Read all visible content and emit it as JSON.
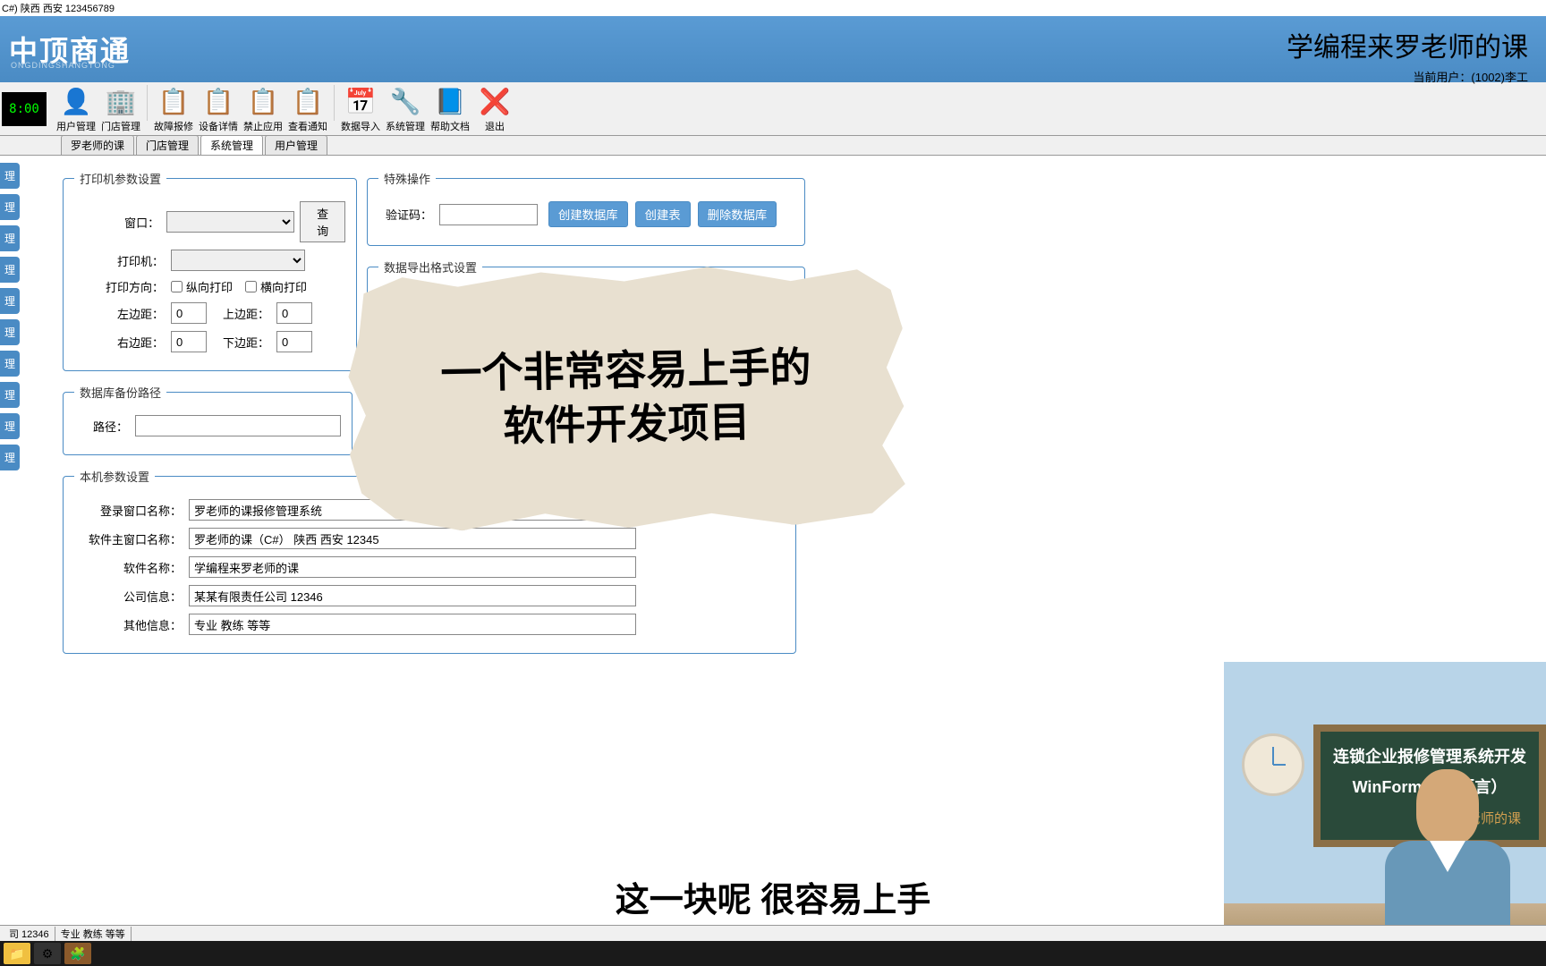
{
  "titlebar": "C#)   陕西 西安 123456789",
  "logo": "中顶商通",
  "logo_sub": "ONGDINGSHANGTONG",
  "slogan": "学编程来罗老师的课",
  "user_info": "当前用户：(1002)李工",
  "clock": "8:00",
  "toolbar": [
    {
      "icon": "👤",
      "label": "用户管理"
    },
    {
      "icon": "🏢",
      "label": "门店管理"
    },
    {
      "icon": "📋",
      "label": "故障报修"
    },
    {
      "icon": "📋",
      "label": "设备详情"
    },
    {
      "icon": "📋",
      "label": "禁止应用"
    },
    {
      "icon": "📋",
      "label": "查看通知"
    },
    {
      "icon": "📅",
      "label": "数据导入"
    },
    {
      "icon": "🔧",
      "label": "系统管理"
    },
    {
      "icon": "📘",
      "label": "帮助文档"
    },
    {
      "icon": "❌",
      "label": "退出"
    }
  ],
  "tabs": [
    "罗老师的课",
    "门店管理",
    "系统管理",
    "用户管理"
  ],
  "active_tab": 2,
  "side_tabs": [
    "理",
    "理",
    "理",
    "理",
    "理",
    "理",
    "理",
    "理",
    "理",
    "理"
  ],
  "printer": {
    "legend": "打印机参数设置",
    "window_label": "窗口：",
    "query_btn": "查询",
    "printer_label": "打印机：",
    "direction_label": "打印方向：",
    "portrait": "纵向打印",
    "landscape": "横向打印",
    "left_margin_label": "左边距：",
    "left_margin": "0",
    "top_margin_label": "上边距：",
    "top_margin": "0",
    "right_margin_label": "右边距：",
    "right_margin": "0",
    "bottom_margin_label": "下边距：",
    "bottom_margin": "0"
  },
  "special": {
    "legend": "特殊操作",
    "code_label": "验证码：",
    "create_db": "创建数据库",
    "create_table": "创建表",
    "delete_db": "删除数据库"
  },
  "export": {
    "legend": "数据导出格式设置"
  },
  "backup": {
    "legend": "数据库备份路径",
    "path_label": "路径："
  },
  "local": {
    "legend": "本机参数设置",
    "login_label": "登录窗口名称：",
    "login_val": "罗老师的课报修管理系统",
    "main_label": "软件主窗口名称：",
    "main_val": "罗老师的课（C#） 陕西 西安 12345",
    "soft_label": "软件名称：",
    "soft_val": "学编程来罗老师的课",
    "company_label": "公司信息：",
    "company_val": "某某有限责任公司 12346",
    "other_label": "其他信息：",
    "other_val": "专业 教练 等等"
  },
  "paper": {
    "line1": "一个非常容易上手的",
    "line2": "软件开发项目"
  },
  "subtitle": "这一块呢 很容易上手",
  "board": {
    "line1": "连锁企业报修管理系统开发",
    "line2": "WinForm（C#语言）",
    "line3": "-罗老师的课"
  },
  "status": {
    "seg1": "司 12346",
    "seg2": "专业 教练 等等"
  }
}
